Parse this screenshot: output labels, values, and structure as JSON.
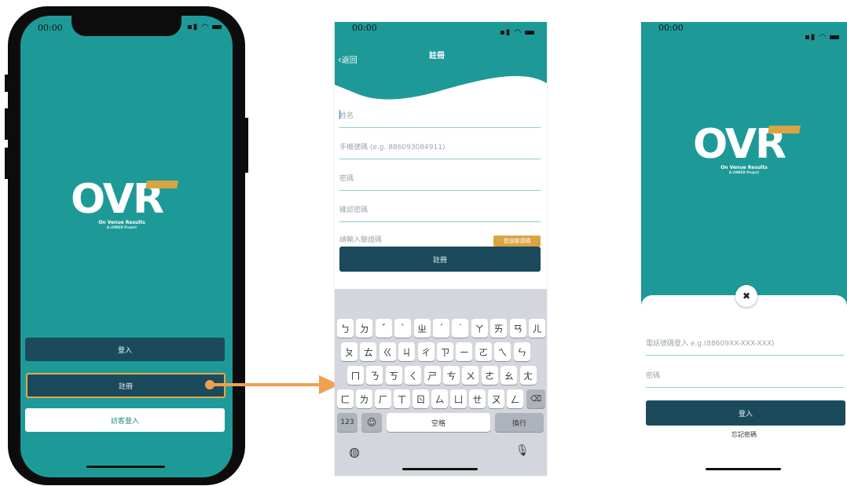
{
  "status": {
    "time": "00:00",
    "icons": "signal wifi battery"
  },
  "logo": {
    "word": "OVR",
    "tagline": "On Venue Results",
    "subtag": "A LINKER Project"
  },
  "screen1": {
    "login": "登入",
    "register": "註冊",
    "guest": "訪客登入"
  },
  "screen2": {
    "back": "返回",
    "title": "註冊",
    "fields": [
      "姓名",
      "手機號碼 (e.g. 886093084911)",
      "密碼",
      "確認密碼",
      "請輸入驗證碼"
    ],
    "send_code": "發送驗證碼",
    "submit": "註冊",
    "keyboard": {
      "row1": [
        "ㄅ",
        "ㄉ",
        "ˇ",
        "ˋ",
        "ㄓ",
        "ˊ",
        "˙",
        "ㄚ",
        "ㄞ",
        "ㄢ",
        "ㄦ"
      ],
      "row2": [
        "ㄆ",
        "ㄊ",
        "ㄍ",
        "ㄐ",
        "ㄔ",
        "ㄗ",
        "ㄧ",
        "ㄛ",
        "ㄟ",
        "ㄣ"
      ],
      "row3": [
        "ㄇ",
        "ㄋ",
        "ㄎ",
        "ㄑ",
        "ㄕ",
        "ㄘ",
        "ㄨ",
        "ㄜ",
        "ㄠ",
        "ㄤ"
      ],
      "row4": [
        "ㄈ",
        "ㄌ",
        "ㄏ",
        "ㄒ",
        "ㄖ",
        "ㄙ",
        "ㄩ",
        "ㄝ",
        "ㄡ",
        "ㄥ"
      ],
      "num": "123",
      "space": "空格",
      "enter": "換行"
    }
  },
  "screen3": {
    "phone_placeholder": "電話號碼登入 e.g.(88609XX-XXX-XXX)",
    "password": "密碼",
    "login": "登入",
    "forgot": "忘記密碼"
  },
  "icons": {
    "close": "close-icon",
    "backspace": "backspace-icon",
    "emoji": "emoji-icon",
    "globe": "globe-icon",
    "mic": "microphone-icon",
    "back": "chevron-left-icon"
  },
  "colors": {
    "teal": "#1d9a98",
    "navy": "#1c4a5d",
    "gold": "#d9a441",
    "arrow": "#f0a050"
  }
}
